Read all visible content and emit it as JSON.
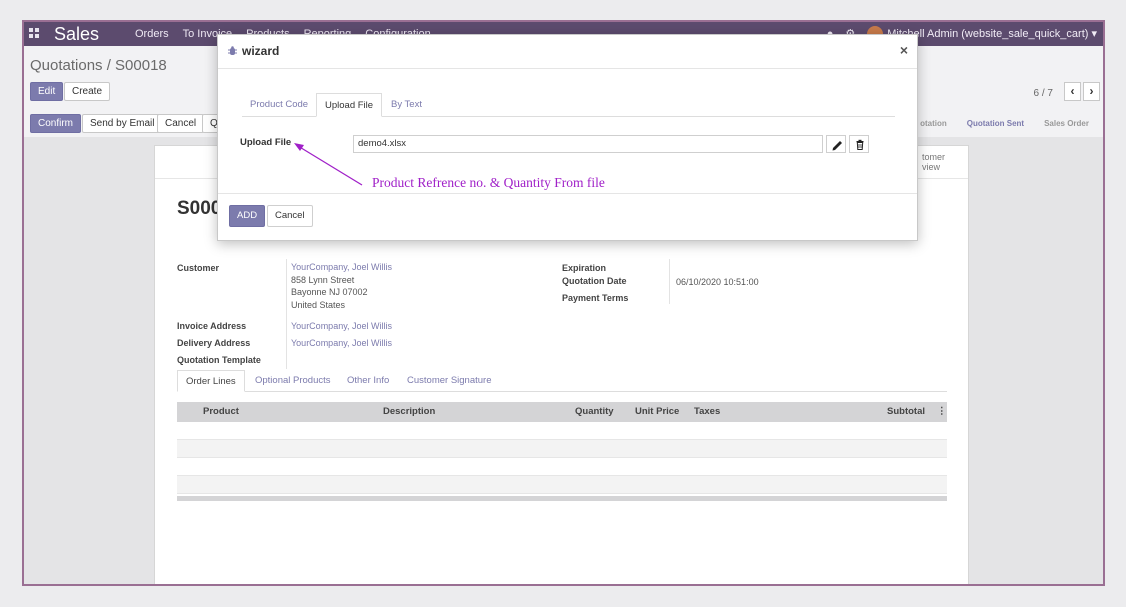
{
  "navbar": {
    "app_name": "Sales",
    "menu": [
      "Orders",
      "To Invoice",
      "Products",
      "Reporting",
      "Configuration"
    ],
    "user": "Mitchell Admin (website_sale_quick_cart)"
  },
  "control_panel": {
    "breadcrumb": "Quotations / S00018",
    "edit_label": "Edit",
    "create_label": "Create",
    "pager": "6 / 7",
    "prev_icon": "chevron-left-icon",
    "next_icon": "chevron-right-icon"
  },
  "actions": {
    "confirm_label": "Confirm",
    "send_email_label": "Send by Email",
    "cancel_label": "Cancel",
    "q_label": "Q"
  },
  "status": {
    "steps": [
      "otation",
      "Quotation Sent",
      "Sales Order"
    ],
    "active": 1
  },
  "sheet": {
    "preview_line1": "tomer",
    "preview_line2": "view",
    "title": "S000",
    "customer_label": "Customer",
    "customer_name": "YourCompany, Joel Willis",
    "customer_street": "858 Lynn Street",
    "customer_city": "Bayonne NJ 07002",
    "customer_country": "United States",
    "invoice_address_label": "Invoice Address",
    "invoice_address": "YourCompany, Joel Willis",
    "delivery_address_label": "Delivery Address",
    "delivery_address": "YourCompany, Joel Willis",
    "quotation_template_label": "Quotation Template",
    "expiration_label": "Expiration",
    "quotation_date_label": "Quotation Date",
    "quotation_date": "06/10/2020 10:51:00",
    "payment_terms_label": "Payment Terms",
    "tabs": [
      "Order Lines",
      "Optional Products",
      "Other Info",
      "Customer Signature"
    ],
    "columns": {
      "product": "Product",
      "description": "Description",
      "quantity": "Quantity",
      "unit_price": "Unit Price",
      "taxes": "Taxes",
      "subtotal": "Subtotal"
    }
  },
  "wizard": {
    "title": "wizard",
    "close": "×",
    "tabs": [
      "Product Code",
      "Upload File",
      "By Text"
    ],
    "active_tab": 1,
    "upload_label": "Upload File",
    "file_value": "demo4.xlsx",
    "edit_icon": "pencil-icon",
    "delete_icon": "trash-icon",
    "annotation": "Product Refrence no. & Quantity From file",
    "annotation_color": "#a020c8",
    "add_label": "ADD",
    "cancel_label": "Cancel"
  },
  "colors": {
    "navbar": "#5c4b6e",
    "primary": "#7c7bad",
    "frame_border": "#9a6f93"
  }
}
